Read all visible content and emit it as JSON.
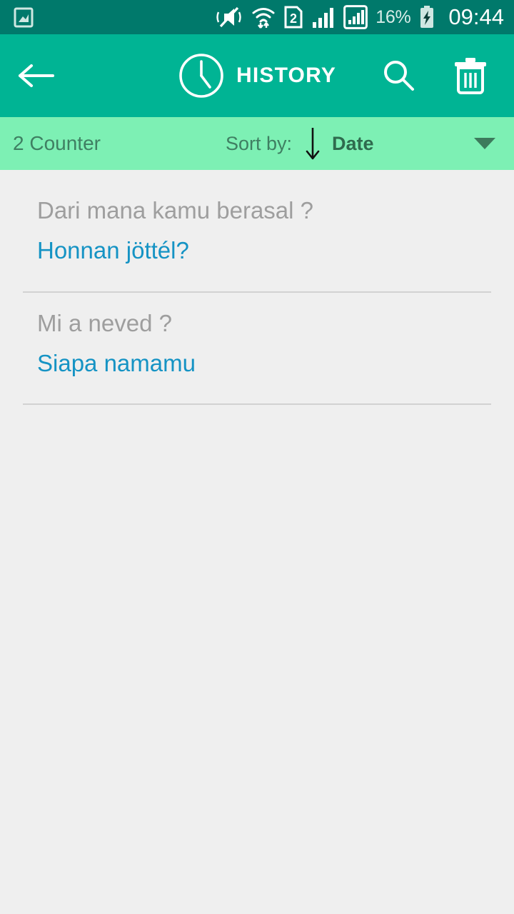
{
  "status_bar": {
    "background_color": "#00796B",
    "left_icons": [
      {
        "name": "screenshot-image-icon",
        "label": "image"
      }
    ],
    "right_icons": [
      {
        "name": "vibrate-mute-icon",
        "label": "mute-vibrate"
      },
      {
        "name": "wifi-transfer-icon",
        "label": "wifi"
      },
      {
        "name": "sim-2-icon",
        "label": "2"
      },
      {
        "name": "signal-bars-icon",
        "label": "signal"
      },
      {
        "name": "signal-bars-boxed-icon",
        "label": "signal-2"
      }
    ],
    "battery_percent": "16%",
    "battery_charging": true,
    "clock": "09:44"
  },
  "app_bar": {
    "background_color": "#00B494",
    "back_label": "Back",
    "clock_icon": "clock-icon",
    "title": "HISTORY",
    "search_label": "Search",
    "delete_label": "Delete all"
  },
  "sort_bar": {
    "background_color": "#7DF0B4",
    "counter": "2 Counter",
    "sort_by_label": "Sort by:",
    "sort_direction": "descending",
    "sort_value": "Date",
    "dropdown_icon": "chevron-down-icon"
  },
  "history": {
    "items": [
      {
        "source_text": "Dari mana kamu berasal ?",
        "target_text": "Honnan jöttél?"
      },
      {
        "source_text": "Mi a neved ?",
        "target_text": "Siapa namamu"
      }
    ]
  },
  "colors": {
    "body_background": "#EFEFEF",
    "source_text": "#9E9E9E",
    "target_text": "#1593C4",
    "divider": "#D2D2D2"
  }
}
